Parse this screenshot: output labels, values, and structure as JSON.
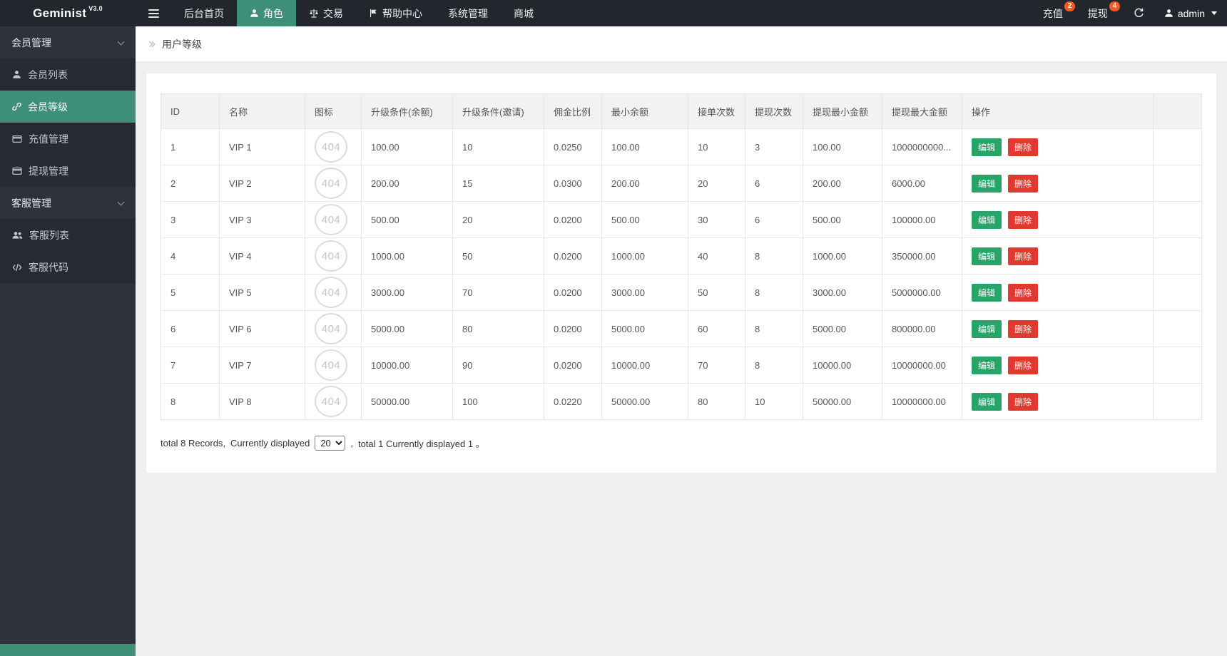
{
  "colors": {
    "accent": "#3d8f78",
    "edit_button": "#27a568",
    "delete_button": "#e0392f",
    "badge": "#ff5722",
    "topbar_bg": "#24262e",
    "sidebar_bg": "#2f323d"
  },
  "brand": {
    "name": "Geminist",
    "version": "V3.0"
  },
  "topnav": {
    "items": [
      {
        "label": "后台首页"
      },
      {
        "label": "角色",
        "icon": "person-icon",
        "active": true
      },
      {
        "label": "交易",
        "icon": "scale-icon"
      },
      {
        "label": "帮助中心",
        "icon": "flag-icon"
      },
      {
        "label": "系统管理"
      },
      {
        "label": "商城"
      }
    ],
    "recharge": {
      "label": "充值",
      "badge": "2"
    },
    "withdraw": {
      "label": "提现",
      "badge": "4"
    },
    "refresh_icon": "refresh-icon",
    "username": "admin"
  },
  "sidebar": {
    "groups": [
      {
        "label": "会员管理",
        "expanded": true,
        "items": [
          {
            "label": "会员列表",
            "icon": "user-icon"
          },
          {
            "label": "会员等级",
            "icon": "link-icon",
            "active": true
          },
          {
            "label": "充值管理",
            "icon": "card-icon"
          },
          {
            "label": "提现管理",
            "icon": "card-icon"
          }
        ]
      },
      {
        "label": "客服管理",
        "expanded": true,
        "items": [
          {
            "label": "客服列表",
            "icon": "users-icon"
          },
          {
            "label": "客服代码",
            "icon": "code-icon"
          }
        ]
      }
    ]
  },
  "breadcrumb": {
    "title": "用户等级"
  },
  "table": {
    "columns": [
      "ID",
      "名称",
      "图标",
      "升级条件(余额)",
      "升级条件(邀请)",
      "佣金比例",
      "最小余额",
      "接单次数",
      "提现次数",
      "提现最小金额",
      "提现最大金额",
      "操作"
    ],
    "icon_placeholder": "404",
    "actions": {
      "edit": "编辑",
      "delete": "删除"
    },
    "rows": [
      {
        "id": "1",
        "name": "VIP 1",
        "upgrade_balance": "100.00",
        "upgrade_invite": "10",
        "commission": "0.0250",
        "min_balance": "100.00",
        "order_count": "10",
        "withdraw_count": "3",
        "withdraw_min": "100.00",
        "withdraw_max": "1000000000..."
      },
      {
        "id": "2",
        "name": "VIP 2",
        "upgrade_balance": "200.00",
        "upgrade_invite": "15",
        "commission": "0.0300",
        "min_balance": "200.00",
        "order_count": "20",
        "withdraw_count": "6",
        "withdraw_min": "200.00",
        "withdraw_max": "6000.00"
      },
      {
        "id": "3",
        "name": "VIP 3",
        "upgrade_balance": "500.00",
        "upgrade_invite": "20",
        "commission": "0.0200",
        "min_balance": "500.00",
        "order_count": "30",
        "withdraw_count": "6",
        "withdraw_min": "500.00",
        "withdraw_max": "100000.00"
      },
      {
        "id": "4",
        "name": "VIP 4",
        "upgrade_balance": "1000.00",
        "upgrade_invite": "50",
        "commission": "0.0200",
        "min_balance": "1000.00",
        "order_count": "40",
        "withdraw_count": "8",
        "withdraw_min": "1000.00",
        "withdraw_max": "350000.00"
      },
      {
        "id": "5",
        "name": "VIP 5",
        "upgrade_balance": "3000.00",
        "upgrade_invite": "70",
        "commission": "0.0200",
        "min_balance": "3000.00",
        "order_count": "50",
        "withdraw_count": "8",
        "withdraw_min": "3000.00",
        "withdraw_max": "5000000.00"
      },
      {
        "id": "6",
        "name": "VIP 6",
        "upgrade_balance": "5000.00",
        "upgrade_invite": "80",
        "commission": "0.0200",
        "min_balance": "5000.00",
        "order_count": "60",
        "withdraw_count": "8",
        "withdraw_min": "5000.00",
        "withdraw_max": "800000.00"
      },
      {
        "id": "7",
        "name": "VIP 7",
        "upgrade_balance": "10000.00",
        "upgrade_invite": "90",
        "commission": "0.0200",
        "min_balance": "10000.00",
        "order_count": "70",
        "withdraw_count": "8",
        "withdraw_min": "10000.00",
        "withdraw_max": "10000000.00"
      },
      {
        "id": "8",
        "name": "VIP 8",
        "upgrade_balance": "50000.00",
        "upgrade_invite": "100",
        "commission": "0.0220",
        "min_balance": "50000.00",
        "order_count": "80",
        "withdraw_count": "10",
        "withdraw_min": "50000.00",
        "withdraw_max": "10000000.00"
      }
    ]
  },
  "pagination": {
    "total_text": "total 8 Records,",
    "display_label": "Currently displayed",
    "page_size": "20",
    "separator": ",",
    "page_info": "total 1 Currently displayed 1 。"
  }
}
